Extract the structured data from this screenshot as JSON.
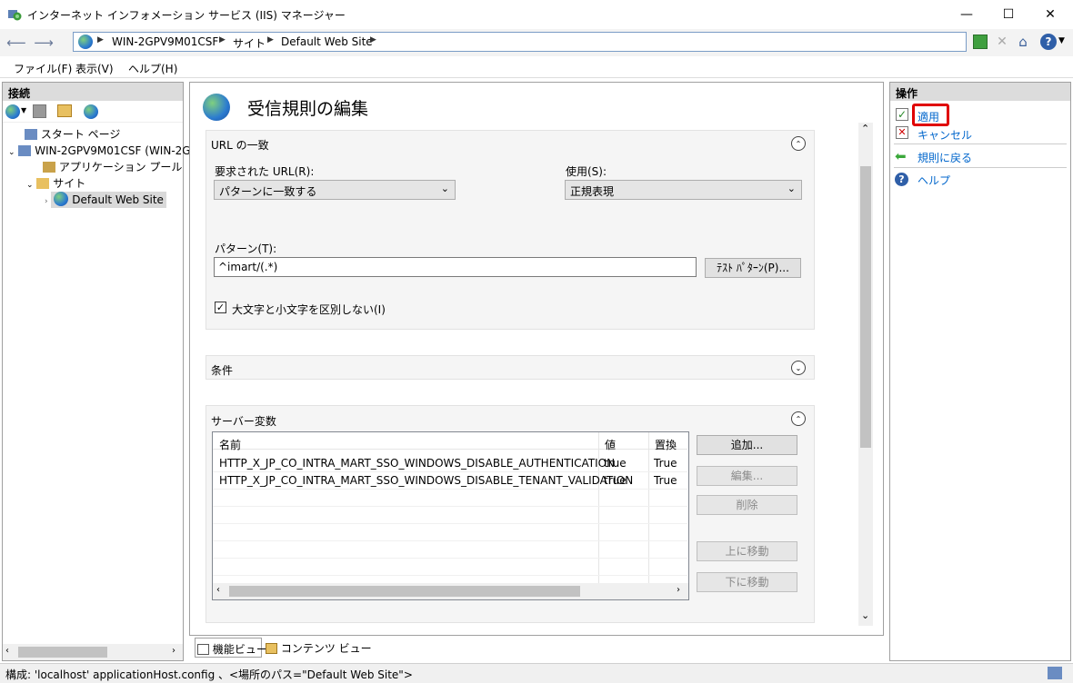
{
  "window": {
    "title": "インターネット インフォメーション サービス (IIS) マネージャー",
    "minimize": "—",
    "maximize": "☐",
    "close": "✕"
  },
  "address": {
    "crumbs": [
      "WIN-2GPV9M01CSF",
      "サイト",
      "Default Web Site"
    ]
  },
  "menu": [
    "ファイル(F)",
    "表示(V)",
    "ヘルプ(H)"
  ],
  "connections": {
    "title": "接続",
    "tree": [
      {
        "label": "スタート ページ",
        "depth": 1
      },
      {
        "label": "WIN-2GPV9M01CSF (WIN-2GI",
        "depth": 0
      },
      {
        "label": "アプリケーション プール",
        "depth": 1
      },
      {
        "label": "サイト",
        "depth": 1
      },
      {
        "label": "Default Web Site",
        "depth": 2,
        "selected": true
      }
    ]
  },
  "main": {
    "heading": "受信規則の編集",
    "url_section": {
      "title": "URL の一致",
      "requested_label": "要求された URL(R):",
      "requested_value": "パターンに一致する",
      "using_label": "使用(S):",
      "using_value": "正規表現",
      "pattern_label": "パターン(T):",
      "pattern_value": "^imart/(.*)",
      "test_button": "ﾃｽﾄ ﾊﾟﾀｰﾝ(P)...",
      "ignore_case_label": "大文字と小文字を区別しない(I)",
      "ignore_case_checked": true
    },
    "conditions_section": {
      "title": "条件"
    },
    "server_vars_section": {
      "title": "サーバー変数",
      "columns": [
        "名前",
        "値",
        "置換"
      ],
      "rows": [
        [
          "HTTP_X_JP_CO_INTRA_MART_SSO_WINDOWS_DISABLE_AUTHENTICATION",
          "true",
          "True"
        ],
        [
          "HTTP_X_JP_CO_INTRA_MART_SSO_WINDOWS_DISABLE_TENANT_VALIDATION",
          "true",
          "True"
        ]
      ],
      "buttons": {
        "add": "追加...",
        "edit": "編集...",
        "delete": "削除",
        "move_up": "上に移動",
        "move_down": "下に移動"
      }
    }
  },
  "actions": {
    "title": "操作",
    "apply": "適用",
    "cancel": "キャンセル",
    "back": "規則に戻る",
    "help": "ヘルプ"
  },
  "tabs": {
    "features": "機能ビュー",
    "content": "コンテンツ ビュー"
  },
  "status": {
    "text": "構成: 'localhost' applicationHost.config 、<場所のパス=\"Default Web Site\">"
  },
  "colors": {
    "highlight_box": "#e00000",
    "link": "#0066cc"
  }
}
